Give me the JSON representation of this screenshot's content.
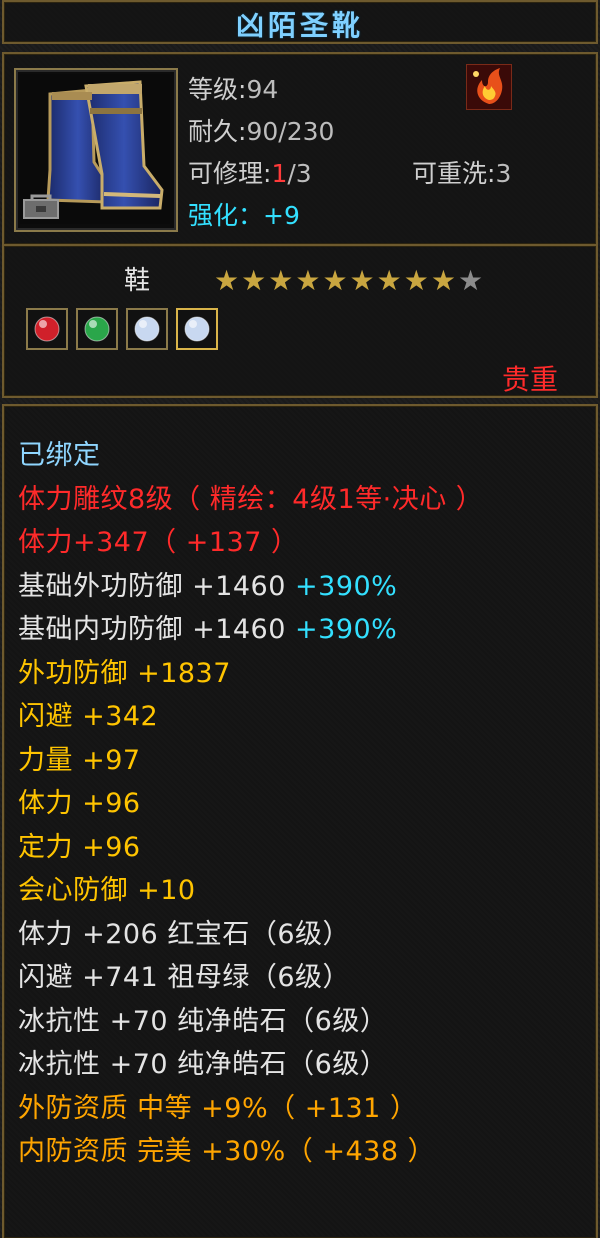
{
  "item": {
    "name": "凶陌圣靴",
    "level_label": "等级",
    "level_sep": ":",
    "level": "94",
    "durability_label": "耐久",
    "durability_sep": ":",
    "durability": "90/230",
    "repair_label": "可修理",
    "repair_sep": ":",
    "repair_used": "1",
    "repair_total": "/3",
    "rewash_label": "可重洗",
    "rewash_sep": ":",
    "rewash": "3",
    "enhance_label": "强化：",
    "enhance": "+9",
    "slot": "鞋",
    "stars_filled": 9,
    "stars_total": 10,
    "quality": "贵重",
    "icon": "blue-boots-icon",
    "colors": {
      "title": "#7fd0ff",
      "red": "#ff2a2a",
      "gold": "#ffc400",
      "orange": "#ffa500",
      "cyan": "#33e0ff",
      "border": "#6e5a2e"
    }
  },
  "gems": [
    {
      "name": "ruby-gem-icon",
      "color": "#d0202a"
    },
    {
      "name": "emerald-gem-icon",
      "color": "#2aa64a"
    },
    {
      "name": "diamond-gem-icon",
      "color": "#c8d8f0"
    },
    {
      "name": "diamond-gem-icon",
      "color": "#c8d8f0"
    }
  ],
  "attributes": {
    "bound": "已绑定",
    "carving": "体力雕纹8级（ 精绘：4级1等·决心 ）",
    "stamina_carve": "体力+347（ +137 ）",
    "base_out_def": "基础外功防御  +1460 ",
    "base_out_def_pct": "+390%",
    "base_in_def": "基础内功防御  +1460 ",
    "base_in_def_pct": "+390%",
    "out_def": "外功防御  +1837",
    "dodge": "闪避  +342",
    "strength": "力量  +97",
    "stamina": "体力  +96",
    "focus": "定力  +96",
    "crit_def": "会心防御  +10",
    "gem1": "体力  +206  红宝石（6级）",
    "gem2": "闪避  +741  祖母绿（6级）",
    "gem3": "冰抗性  +70  纯净皓石（6级）",
    "gem4": "冰抗性  +70  纯净皓石（6级）",
    "out_quality": "外防资质   中等  +9%（ +131 ）",
    "in_quality": "内防资质   完美  +30%（ +438 ）"
  }
}
